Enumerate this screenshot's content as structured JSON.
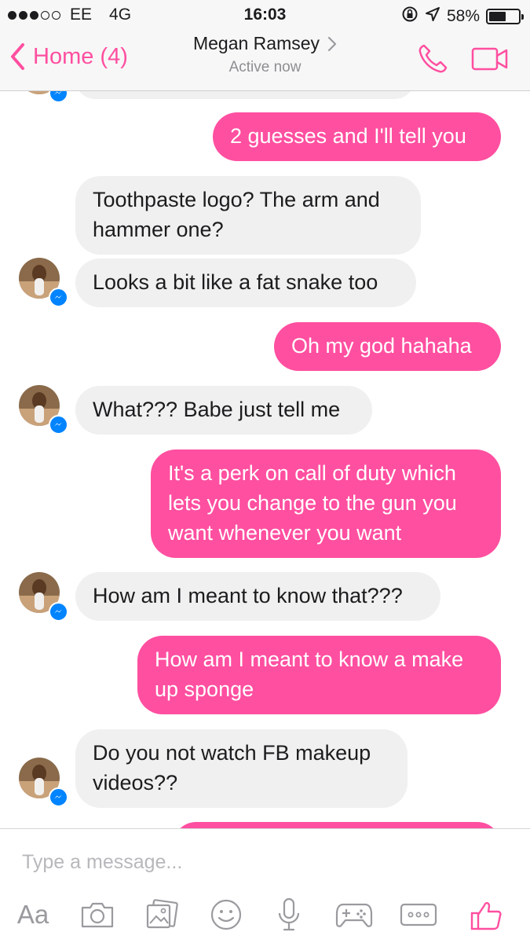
{
  "status_bar": {
    "carrier": "EE",
    "network": "4G",
    "time": "16:03",
    "battery": "58%",
    "battery_level": 0.58
  },
  "nav": {
    "back_label": "Home (4)",
    "contact_name": "Megan Ramsey",
    "active_status": "Active now"
  },
  "colors": {
    "accent": "#ff4fa0",
    "incoming_bubble": "#f0f0f0",
    "messenger_badge": "#0084ff"
  },
  "messages": [
    {
      "direction": "out",
      "text": "2 guesses and I'll tell you"
    },
    {
      "direction": "in",
      "text": "Toothpaste logo? The arm and\nhammer one?"
    },
    {
      "direction": "in",
      "text": "Looks a bit like a fat snake too"
    },
    {
      "direction": "out",
      "text": "Oh my god hahaha"
    },
    {
      "direction": "in",
      "text": "What??? Babe just tell me"
    },
    {
      "direction": "out",
      "text": "It's a perk on call of duty which\nlets you change to the gun you\nwant whenever you want"
    },
    {
      "direction": "in",
      "text": "How am I meant to know that???"
    },
    {
      "direction": "out",
      "text": "How am I meant to know a make\nup sponge"
    },
    {
      "direction": "in",
      "text": "Do you not watch FB makeup\nvideos??"
    }
  ],
  "composer": {
    "placeholder": "Type a message...",
    "text_format_label": "Aa",
    "icons": [
      "camera-icon",
      "gallery-icon",
      "emoji-icon",
      "microphone-icon",
      "game-icon",
      "more-icon",
      "like-icon"
    ]
  }
}
